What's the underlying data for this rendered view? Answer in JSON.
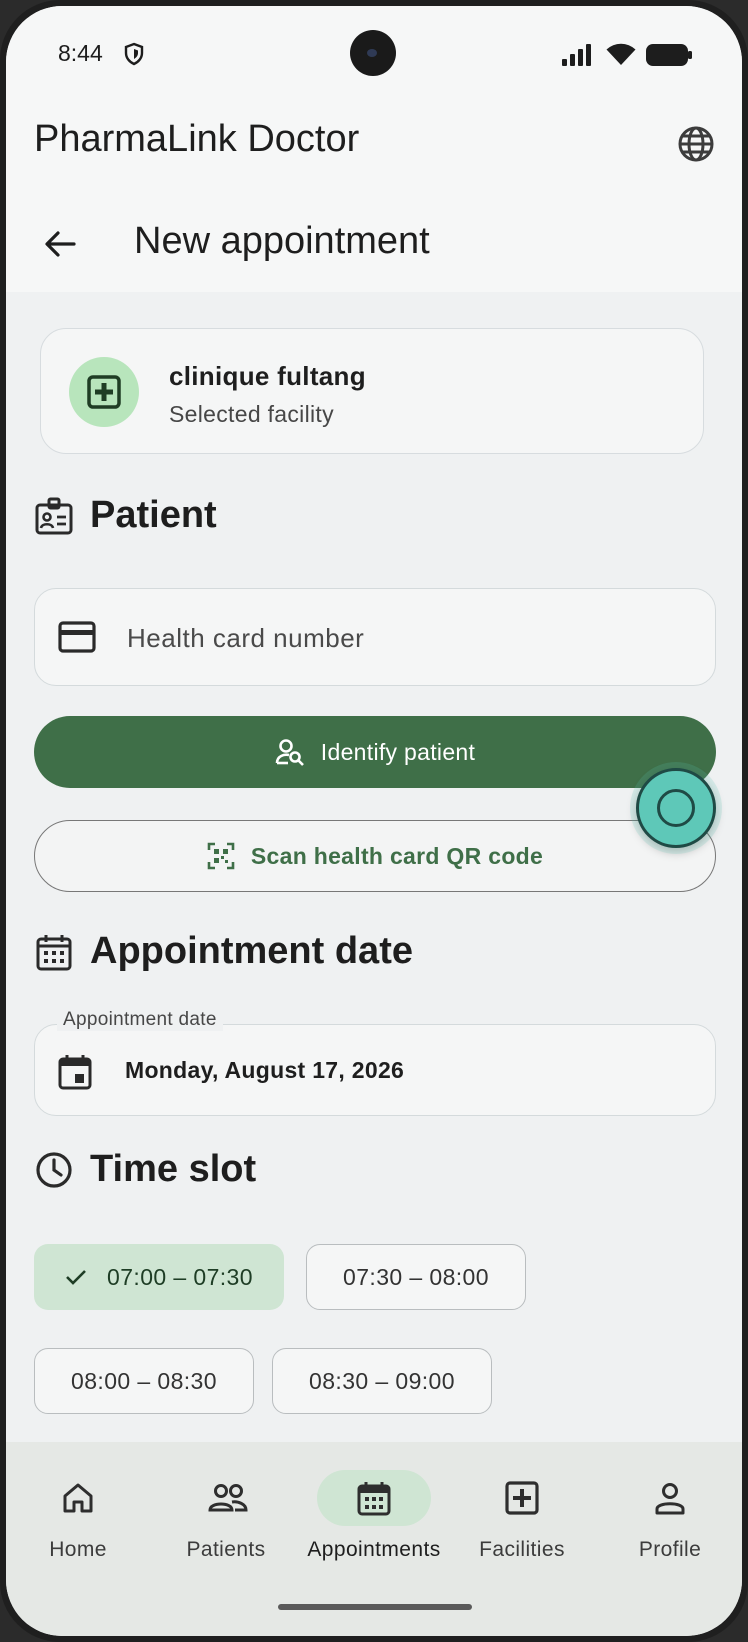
{
  "status_bar": {
    "time": "8:44"
  },
  "app_bar": {
    "title": "PharmaLink Doctor"
  },
  "page": {
    "title": "New appointment"
  },
  "facility": {
    "name": "clinique fultang",
    "subtitle": "Selected facility"
  },
  "patient_section": {
    "title": "Patient",
    "health_card_placeholder": "Health card number",
    "identify_button": "Identify patient",
    "scan_button": "Scan health card QR code"
  },
  "date_section": {
    "title": "Appointment date",
    "field_label": "Appointment date",
    "value": "Monday, August 17, 2026"
  },
  "time_section": {
    "title": "Time slot",
    "slots": [
      {
        "label": "07:00 – 07:30",
        "selected": true
      },
      {
        "label": "07:30 – 08:00",
        "selected": false
      },
      {
        "label": "08:00 – 08:30",
        "selected": false
      },
      {
        "label": "08:30 – 09:00",
        "selected": false
      }
    ]
  },
  "bottom_nav": {
    "items": [
      {
        "label": "Home",
        "icon": "home-icon",
        "active": false
      },
      {
        "label": "Patients",
        "icon": "patients-icon",
        "active": false
      },
      {
        "label": "Appointments",
        "icon": "calendar-icon",
        "active": true
      },
      {
        "label": "Facilities",
        "icon": "hospital-plus-icon",
        "active": false
      },
      {
        "label": "Profile",
        "icon": "person-icon",
        "active": false
      }
    ]
  },
  "colors": {
    "primary": "#3f6f48",
    "selected_chip": "#cfe5d3",
    "facility_icon_bg": "#b8e5bc",
    "background": "#eff1f2"
  }
}
